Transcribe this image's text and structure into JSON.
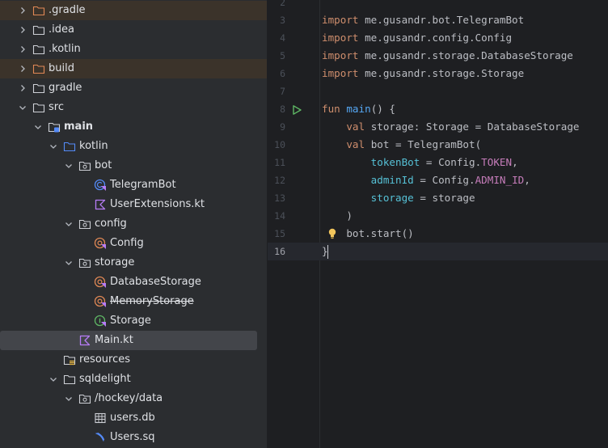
{
  "project_tree": [
    {
      "label": ".gradle",
      "type": "folder",
      "state": "collapsed",
      "depth": 0,
      "excluded": true
    },
    {
      "label": ".idea",
      "type": "folder",
      "state": "collapsed",
      "depth": 0
    },
    {
      "label": ".kotlin",
      "type": "folder",
      "state": "collapsed",
      "depth": 0
    },
    {
      "label": "build",
      "type": "folder",
      "state": "collapsed",
      "depth": 0,
      "excluded": true
    },
    {
      "label": "gradle",
      "type": "folder",
      "state": "collapsed",
      "depth": 0
    },
    {
      "label": "src",
      "type": "folder",
      "state": "expanded",
      "depth": 0
    },
    {
      "label": "main",
      "type": "source-root",
      "state": "expanded",
      "depth": 1,
      "bold": true
    },
    {
      "label": "kotlin",
      "type": "blue-folder",
      "state": "expanded",
      "depth": 2
    },
    {
      "label": "bot",
      "type": "package",
      "state": "expanded",
      "depth": 3
    },
    {
      "label": "TelegramBot",
      "type": "kotlin-class",
      "depth": 4
    },
    {
      "label": "UserExtensions.kt",
      "type": "kotlin-file",
      "depth": 4
    },
    {
      "label": "config",
      "type": "package",
      "state": "expanded",
      "depth": 3
    },
    {
      "label": "Config",
      "type": "kotlin-object",
      "depth": 4
    },
    {
      "label": "storage",
      "type": "package",
      "state": "expanded",
      "depth": 3
    },
    {
      "label": "DatabaseStorage",
      "type": "kotlin-object",
      "depth": 4
    },
    {
      "label": "MemoryStorage",
      "type": "kotlin-object",
      "depth": 4,
      "strikethrough": true
    },
    {
      "label": "Storage",
      "type": "kotlin-interface",
      "depth": 4
    },
    {
      "label": "Main.kt",
      "type": "kotlin-file",
      "depth": 3,
      "selected": true
    },
    {
      "label": "resources",
      "type": "resources-folder",
      "state": "leaf",
      "depth": 2
    },
    {
      "label": "sqldelight",
      "type": "folder",
      "state": "expanded",
      "depth": 2
    },
    {
      "label": "/hockey/data",
      "type": "package",
      "state": "expanded",
      "depth": 3
    },
    {
      "label": "users.db",
      "type": "database",
      "depth": 4
    },
    {
      "label": "Users.sq",
      "type": "sql-file",
      "depth": 4
    }
  ],
  "editor": {
    "current_line": 16,
    "lines": [
      {
        "n": "2",
        "tokens": []
      },
      {
        "n": "3",
        "tokens": [
          {
            "t": "import ",
            "c": "k"
          },
          {
            "t": "me.gusandr.bot.TelegramBot",
            "c": ""
          }
        ]
      },
      {
        "n": "4",
        "tokens": [
          {
            "t": "import ",
            "c": "k"
          },
          {
            "t": "me.gusandr.config.Config",
            "c": ""
          }
        ]
      },
      {
        "n": "5",
        "tokens": [
          {
            "t": "import ",
            "c": "k"
          },
          {
            "t": "me.gusandr.storage.DatabaseStorage",
            "c": ""
          }
        ]
      },
      {
        "n": "6",
        "tokens": [
          {
            "t": "import ",
            "c": "k"
          },
          {
            "t": "me.gusandr.storage.Storage",
            "c": ""
          }
        ]
      },
      {
        "n": "7",
        "tokens": []
      },
      {
        "n": "8",
        "run": true,
        "tokens": [
          {
            "t": "fun ",
            "c": "k"
          },
          {
            "t": "main",
            "c": "fn"
          },
          {
            "t": "() {",
            "c": ""
          }
        ]
      },
      {
        "n": "9",
        "tokens": [
          {
            "t": "    "
          },
          {
            "t": "val ",
            "c": "k"
          },
          {
            "t": "storage: Storage = DatabaseStorage",
            "c": ""
          }
        ]
      },
      {
        "n": "10",
        "tokens": [
          {
            "t": "    "
          },
          {
            "t": "val ",
            "c": "k"
          },
          {
            "t": "bot = TelegramBot(",
            "c": ""
          }
        ]
      },
      {
        "n": "11",
        "tokens": [
          {
            "t": "        "
          },
          {
            "t": "tokenBot",
            "c": "pn"
          },
          {
            "t": " = Config.",
            "c": ""
          },
          {
            "t": "TOKEN",
            "c": "cst"
          },
          {
            "t": ",",
            "c": ""
          }
        ]
      },
      {
        "n": "12",
        "tokens": [
          {
            "t": "        "
          },
          {
            "t": "adminId",
            "c": "pn"
          },
          {
            "t": " = Config.",
            "c": ""
          },
          {
            "t": "ADMIN_ID",
            "c": "cst"
          },
          {
            "t": ",",
            "c": ""
          }
        ]
      },
      {
        "n": "13",
        "tokens": [
          {
            "t": "        "
          },
          {
            "t": "storage",
            "c": "pn"
          },
          {
            "t": " = storage",
            "c": ""
          }
        ]
      },
      {
        "n": "14",
        "tokens": [
          {
            "t": "    )",
            "c": ""
          }
        ]
      },
      {
        "n": "15",
        "bulb": true,
        "tokens": [
          {
            "t": "    bot.start()",
            "c": ""
          }
        ]
      },
      {
        "n": "16",
        "caret": true,
        "tokens": [
          {
            "t": "}",
            "c": ""
          }
        ]
      }
    ]
  }
}
